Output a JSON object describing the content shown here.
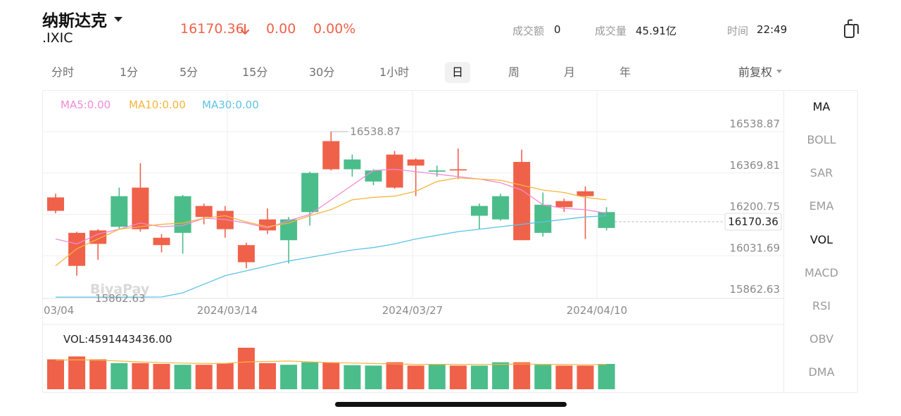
{
  "header": {
    "name": "纳斯达克",
    "symbol": ".IXIC",
    "price": "16170.36",
    "change": "0.00",
    "change_pct": "0.00%",
    "turnover_label": "成交额",
    "turnover_value": "0",
    "volume_label": "成交量",
    "volume_value": "45.91亿",
    "time_label": "时间",
    "time_value": "22:49",
    "down_color": "#f0614a"
  },
  "tabs": [
    "分时",
    "1分",
    "5分",
    "15分",
    "30分",
    "1小时",
    "日",
    "周",
    "月",
    "年"
  ],
  "active_tab": "日",
  "adjust_label": "前复权",
  "indicators": [
    "MA",
    "BOLL",
    "SAR",
    "EMA",
    "VOL",
    "MACD",
    "RSI",
    "OBV",
    "DMA"
  ],
  "active_indicators": [
    "MA",
    "VOL"
  ],
  "ma_legend": {
    "ma5": "MA5:0.00",
    "ma10": "MA10:0.00",
    "ma30": "MA30:0.00"
  },
  "vol_legend": "VOL:4591443436.00",
  "watermark": "BiyaPay",
  "chart_data": {
    "type": "candlestick",
    "y_ticks": [
      "16538.87",
      "16369.81",
      "16200.75",
      "16031.69",
      "15862.63"
    ],
    "x_labels": [
      "03/04",
      "2024/03/14",
      "2024/03/27",
      "2024/04/10"
    ],
    "high_marker": "16538.87",
    "low_marker": "15862.63",
    "last_price_label": "16170.36",
    "colors": {
      "up": "#4bbd8a",
      "down": "#f0614a",
      "ma5": "#f08ad8",
      "ma10": "#f5b53a",
      "ma30": "#5cc3e6"
    },
    "candles": [
      {
        "o": 16270,
        "c": 16215,
        "h": 16285,
        "l": 16205
      },
      {
        "o": 16125,
        "c": 15990,
        "h": 16130,
        "l": 15950
      },
      {
        "o": 16135,
        "c": 16080,
        "h": 16140,
        "l": 16015
      },
      {
        "o": 16150,
        "c": 16275,
        "h": 16310,
        "l": 16140
      },
      {
        "o": 16310,
        "c": 16140,
        "h": 16410,
        "l": 16130
      },
      {
        "o": 16105,
        "c": 16075,
        "h": 16120,
        "l": 16045
      },
      {
        "o": 16125,
        "c": 16275,
        "h": 16280,
        "l": 16040
      },
      {
        "o": 16235,
        "c": 16190,
        "h": 16245,
        "l": 16160
      },
      {
        "o": 16215,
        "c": 16140,
        "h": 16235,
        "l": 16105
      },
      {
        "o": 16075,
        "c": 16005,
        "h": 16085,
        "l": 15980
      },
      {
        "o": 16180,
        "c": 16135,
        "h": 16225,
        "l": 16120
      },
      {
        "o": 16095,
        "c": 16180,
        "h": 16190,
        "l": 16000
      },
      {
        "o": 16210,
        "c": 16370,
        "h": 16375,
        "l": 16155
      },
      {
        "o": 16500,
        "c": 16385,
        "h": 16540,
        "l": 16380
      },
      {
        "o": 16385,
        "c": 16425,
        "h": 16445,
        "l": 16355
      },
      {
        "o": 16335,
        "c": 16380,
        "h": 16385,
        "l": 16320
      },
      {
        "o": 16445,
        "c": 16310,
        "h": 16460,
        "l": 16305
      },
      {
        "o": 16425,
        "c": 16400,
        "h": 16430,
        "l": 16275
      },
      {
        "o": 16375,
        "c": 16380,
        "h": 16400,
        "l": 16355
      },
      {
        "o": 16385,
        "c": 16380,
        "h": 16470,
        "l": 16345
      },
      {
        "o": 16195,
        "c": 16235,
        "h": 16245,
        "l": 16140
      },
      {
        "o": 16180,
        "c": 16275,
        "h": 16285,
        "l": 16175
      },
      {
        "o": 16415,
        "c": 16095,
        "h": 16465,
        "l": 16095
      },
      {
        "o": 16125,
        "c": 16240,
        "h": 16290,
        "l": 16110
      },
      {
        "o": 16255,
        "c": 16230,
        "h": 16265,
        "l": 16210
      },
      {
        "o": 16295,
        "c": 16275,
        "h": 16315,
        "l": 16100
      },
      {
        "o": 16145,
        "c": 16210,
        "h": 16230,
        "l": 16135
      }
    ],
    "ma5": [
      16100,
      16080,
      16120,
      16140,
      16165,
      16150,
      16155,
      16185,
      16180,
      16165,
      16145,
      16175,
      16200,
      16260,
      16320,
      16380,
      16385,
      16375,
      16365,
      16355,
      16345,
      16330,
      16300,
      16240,
      16225,
      16220,
      16205
    ],
    "ma10": [
      15990,
      16060,
      16100,
      16140,
      16150,
      16160,
      16165,
      16185,
      16195,
      16170,
      16150,
      16165,
      16195,
      16220,
      16260,
      16270,
      16275,
      16295,
      16335,
      16350,
      16345,
      16340,
      16320,
      16300,
      16290,
      16270,
      16260
    ],
    "ma30": [
      15862,
      15862,
      15862,
      15862,
      15862,
      15863,
      15880,
      15915,
      15950,
      15970,
      15990,
      16010,
      16025,
      16040,
      16055,
      16065,
      16080,
      16100,
      16115,
      16130,
      16140,
      16150,
      16160,
      16170,
      16180,
      16190,
      16195
    ],
    "volume_label": "VOL:4591443436.00",
    "volumes": [
      0.72,
      0.79,
      0.72,
      0.63,
      0.63,
      0.61,
      0.59,
      0.59,
      0.63,
      1.0,
      0.63,
      0.59,
      0.65,
      0.65,
      0.58,
      0.57,
      0.65,
      0.57,
      0.61,
      0.57,
      0.57,
      0.65,
      0.65,
      0.59,
      0.57,
      0.57,
      0.61
    ],
    "volume_ma": [
      0.7,
      0.71,
      0.7,
      0.68,
      0.66,
      0.64,
      0.63,
      0.62,
      0.62,
      0.66,
      0.67,
      0.68,
      0.66,
      0.64,
      0.63,
      0.62,
      0.61,
      0.6,
      0.6,
      0.6,
      0.6,
      0.6,
      0.61,
      0.6,
      0.6,
      0.59,
      0.6
    ]
  }
}
